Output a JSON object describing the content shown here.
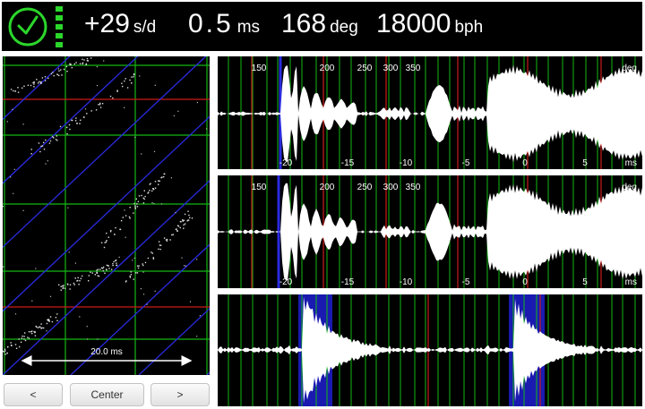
{
  "header": {
    "rate_value": "+29",
    "rate_unit": "s/d",
    "beat_error_value": "0.5",
    "beat_error_unit": "ms",
    "amplitude_value": "168",
    "amplitude_unit": "deg",
    "bph_value": "18000",
    "bph_unit": "bph",
    "icons": {
      "clock": "clock-check-icon",
      "signal": "signal-level-icon"
    },
    "colors": {
      "accent": "#2bd62b",
      "background": "#000000",
      "text": "#ffffff"
    }
  },
  "timegrapher": {
    "scale_label": "20.0 ms",
    "colors": {
      "grid_green": "#14b814",
      "grid_red": "#cc1a1a",
      "diagonal_blue": "#2a2ae0",
      "dots": "#dddddd"
    }
  },
  "waveform_top": {
    "deg_unit": "deg",
    "ms_unit": "ms",
    "deg_labels": [
      "150",
      "200",
      "250",
      "300",
      "350"
    ],
    "ms_labels": [
      "-20",
      "-15",
      "-10",
      "-5",
      "0",
      "5"
    ]
  },
  "waveform_mid": {
    "deg_unit": "deg",
    "ms_unit": "ms",
    "deg_labels": [
      "150",
      "200",
      "250",
      "300",
      "350"
    ],
    "ms_labels": [
      "-20",
      "-15",
      "-10",
      "-5",
      "0",
      "5"
    ]
  },
  "buttons": {
    "prev": "<",
    "center": "Center",
    "next": ">"
  }
}
